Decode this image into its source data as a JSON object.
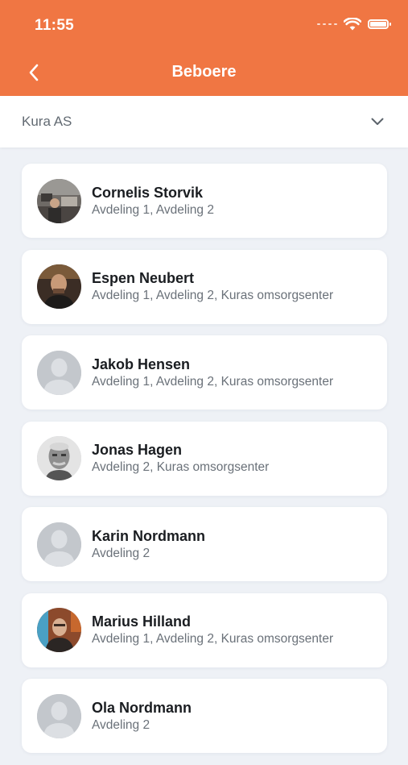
{
  "status_bar": {
    "time": "11:55"
  },
  "header": {
    "title": "Beboere"
  },
  "filter": {
    "selected": "Kura AS"
  },
  "residents": [
    {
      "name": "Cornelis Storvik",
      "departments": "Avdeling 1, Avdeling 2",
      "avatar": "photo"
    },
    {
      "name": "Espen Neubert",
      "departments": "Avdeling 1, Avdeling 2, Kuras omsorgsenter",
      "avatar": "photo"
    },
    {
      "name": "Jakob Hensen",
      "departments": "Avdeling 1, Avdeling 2, Kuras omsorgsenter",
      "avatar": "placeholder"
    },
    {
      "name": "Jonas Hagen",
      "departments": "Avdeling 2, Kuras omsorgsenter",
      "avatar": "photo"
    },
    {
      "name": "Karin Nordmann",
      "departments": "Avdeling 2",
      "avatar": "placeholder"
    },
    {
      "name": "Marius Hilland",
      "departments": "Avdeling 1, Avdeling 2, Kuras omsorgsenter",
      "avatar": "photo"
    },
    {
      "name": "Ola Nordmann",
      "departments": "Avdeling 2",
      "avatar": "placeholder"
    }
  ],
  "colors": {
    "header": "#f07643",
    "background": "#eef1f6",
    "card": "#ffffff"
  }
}
